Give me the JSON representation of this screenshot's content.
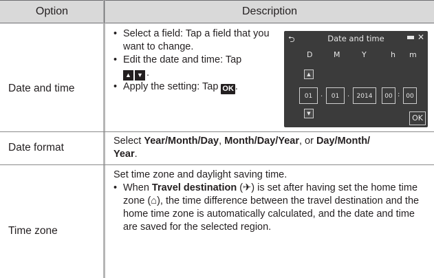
{
  "header": {
    "option": "Option",
    "description": "Description"
  },
  "rows": [
    {
      "option": "Date and time",
      "bullets": {
        "b1": "Select a field: Tap a field that you want to change.",
        "b2_pre": "Edit the date and time: Tap",
        "b2_post": ".",
        "b3_pre": "Apply the setting: Tap",
        "b3_post": "."
      },
      "ok_key": "OK",
      "up_glyph": "▲",
      "down_glyph": "▼",
      "screen": {
        "title": "Date and time",
        "labels": [
          "D",
          "M",
          "Y",
          "h",
          "m"
        ],
        "values": [
          "01",
          "01",
          "2014",
          "00",
          "00"
        ],
        "separators": [
          ".",
          ".",
          ":"
        ],
        "ok_label": "OK",
        "back_glyph": "⮌",
        "close_glyph": "✕",
        "up_glyph": "▲",
        "down_glyph": "▼"
      }
    },
    {
      "option": "Date format",
      "pre": "Select ",
      "f1": "Year/Month/Day",
      "sep1": ", ",
      "f2": "Month/Day/Year",
      "sep2": ", or ",
      "f3": "Day/Month/",
      "f3b": "Year",
      "post": "."
    },
    {
      "option": "Time zone",
      "line1": "Set time zone and daylight saving time.",
      "bullet_pre": "When ",
      "bullet_bold": "Travel destination",
      "bullet_mid": " (",
      "plane_glyph": "✈",
      "bullet_mid2": ") is set after having set the home time zone (",
      "home_glyph": "⌂",
      "bullet_post": "), the time difference between the travel destination and the home time zone is automatically calculated, and the date and time are saved for the selected region."
    }
  ]
}
